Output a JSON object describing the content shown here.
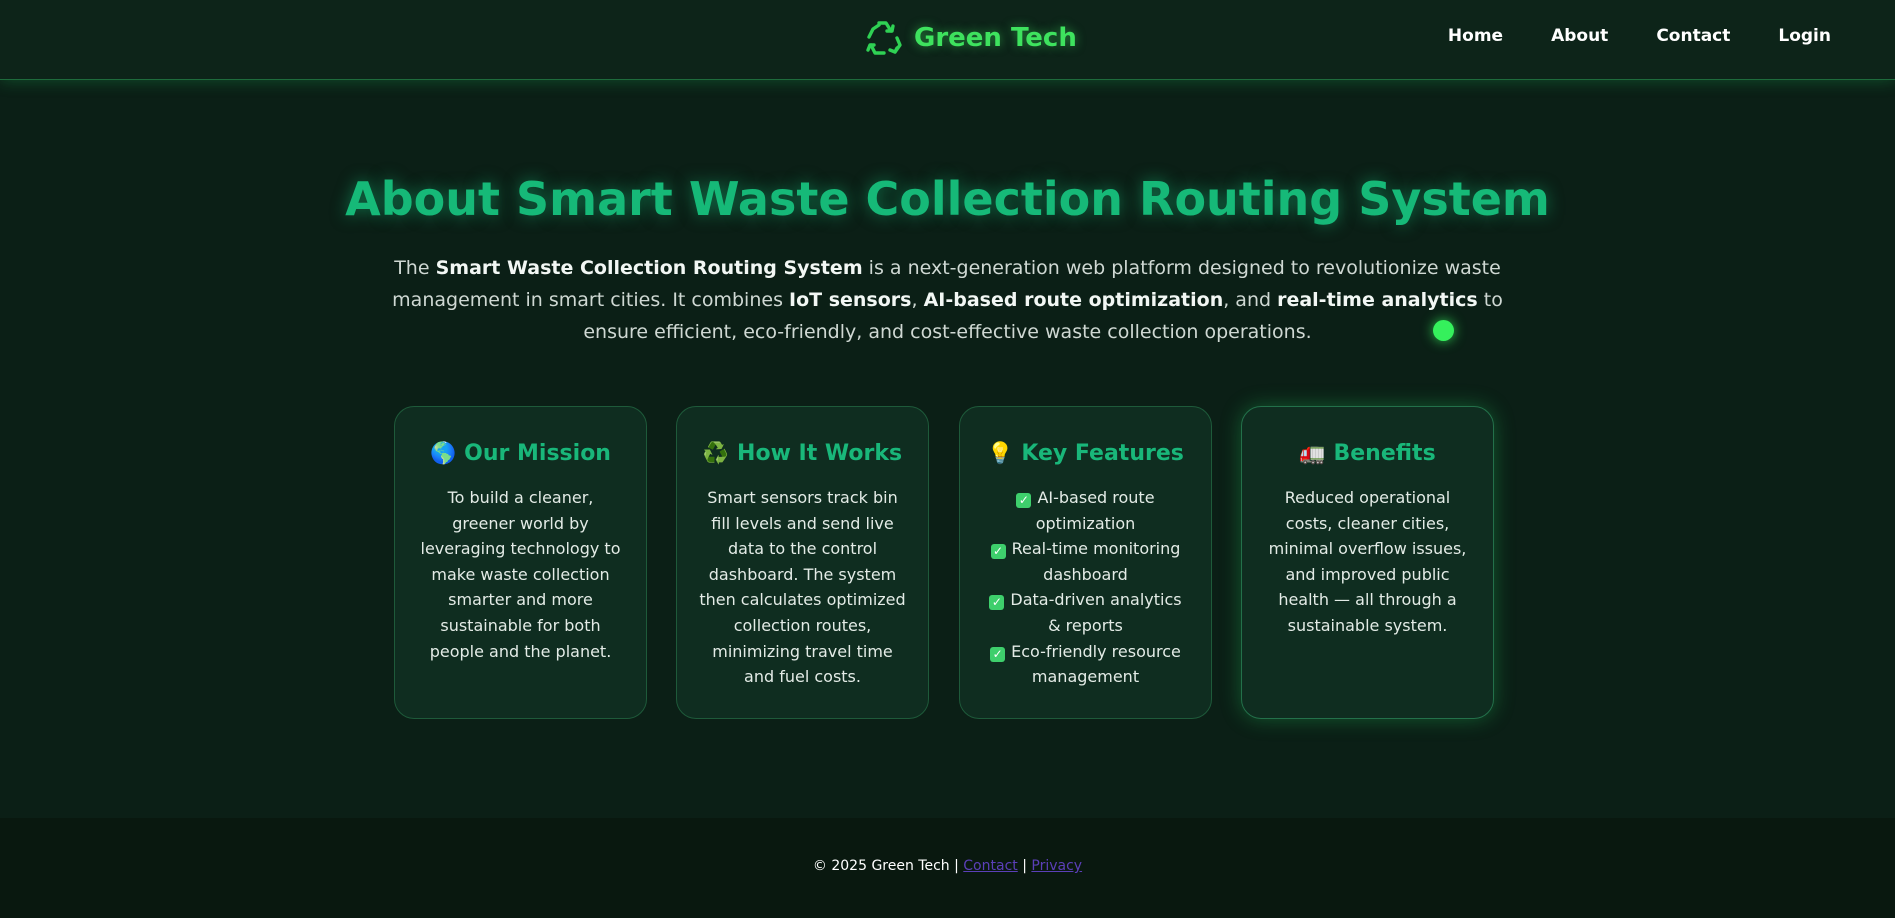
{
  "header": {
    "brand_name": "Green Tech",
    "brand_icon": "recycle-icon",
    "nav": [
      {
        "label": "Home"
      },
      {
        "label": "About"
      },
      {
        "label": "Contact"
      },
      {
        "label": "Login"
      }
    ]
  },
  "hero": {
    "title": "About Smart Waste Collection Routing System",
    "text_parts": {
      "p1": "The ",
      "b1": "Smart Waste Collection Routing System",
      "p2": " is a next-generation web platform designed to revolutionize waste management in smart cities. It combines ",
      "b2": "IoT sensors",
      "p3": ", ",
      "b3": "AI-based route optimization",
      "p4": ", and ",
      "b4": "real-time analytics",
      "p5": " to ensure efficient, eco-friendly, and cost-effective waste collection operations."
    }
  },
  "cards": [
    {
      "emoji": "🌎",
      "icon": "globe-icon",
      "title": "Our Mission",
      "body": "To build a cleaner, greener world by leveraging technology to make waste collection smarter and more sustainable for both people and the planet."
    },
    {
      "emoji": "♻️",
      "icon": "recycle-icon",
      "title": "How It Works",
      "body": "Smart sensors track bin fill levels and send live data to the control dashboard. The system then calculates optimized collection routes, minimizing travel time and fuel costs."
    },
    {
      "emoji": "💡",
      "icon": "lightbulb-icon",
      "title": "Key Features",
      "features": [
        "AI-based route optimization",
        "Real-time monitoring dashboard",
        "Data-driven analytics & reports",
        "Eco-friendly resource management"
      ]
    },
    {
      "emoji": "🚛",
      "icon": "truck-icon",
      "title": "Benefits",
      "body": "Reduced operational costs, cleaner cities, minimal overflow issues, and improved public health — all through a sustainable system."
    }
  ],
  "footer": {
    "copyright": "© 2025 Green Tech",
    "separator": " | ",
    "contact_link": "Contact",
    "privacy_link": "Privacy"
  },
  "colors": {
    "background": "#0b1f16",
    "accent": "#3ee25e",
    "title": "#16b978",
    "card": "#0f2d20"
  }
}
